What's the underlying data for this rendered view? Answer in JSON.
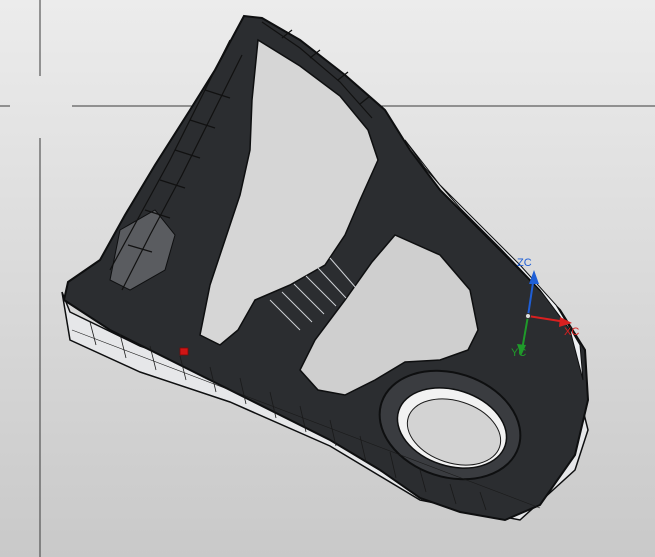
{
  "viewport": {
    "background_top": "#ececec",
    "background_bottom": "#c9c9c9",
    "crosshair_color": "#3a3a3a"
  },
  "model": {
    "body_color": "#2b2d30",
    "edge_color": "#0e0f10",
    "highlight_color": "#f4f4f4",
    "selection_color": "#d01515"
  },
  "csys": {
    "zc_label": "ZC",
    "xc_label": "XC",
    "yc_label": "YC",
    "zc_color": "#1f5fd6",
    "xc_color": "#d92020",
    "yc_color": "#1f9a2a"
  }
}
